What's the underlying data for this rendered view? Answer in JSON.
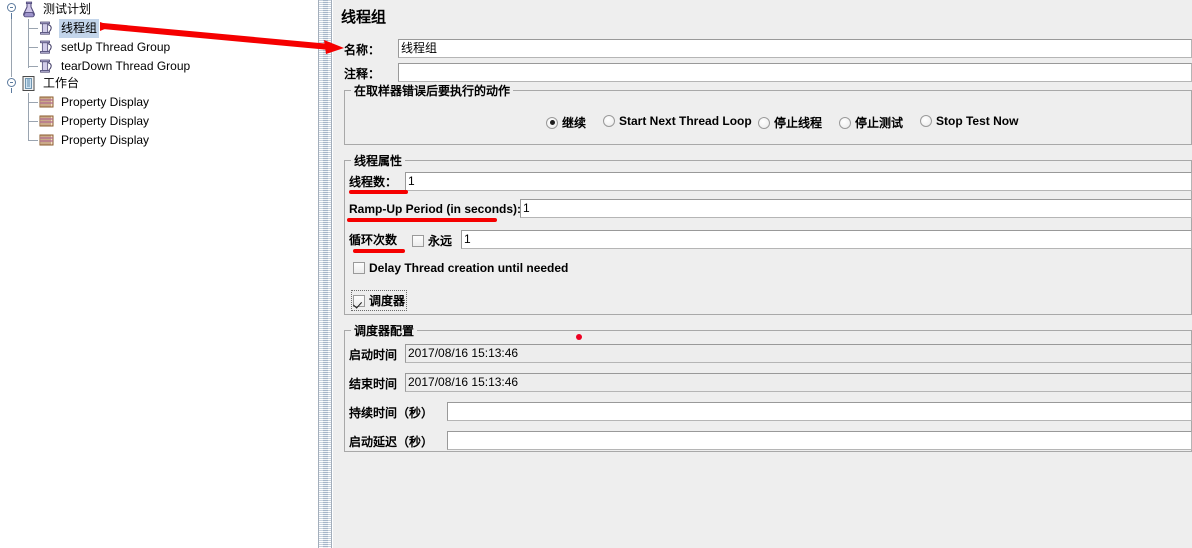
{
  "tree": {
    "items": [
      {
        "label": "测试计划",
        "icon": "flask-icon",
        "depth": 0,
        "selected": false
      },
      {
        "label": "线程组",
        "icon": "thread-group-icon",
        "depth": 1,
        "selected": true
      },
      {
        "label": "setUp Thread Group",
        "icon": "thread-group-icon",
        "depth": 1,
        "selected": false
      },
      {
        "label": "tearDown Thread Group",
        "icon": "thread-group-icon",
        "depth": 1,
        "selected": false
      },
      {
        "label": "工作台",
        "icon": "workbench-icon",
        "depth": 0,
        "selected": false
      },
      {
        "label": "Property Display",
        "icon": "property-display-icon",
        "depth": 1,
        "selected": false
      },
      {
        "label": "Property Display",
        "icon": "property-display-icon",
        "depth": 1,
        "selected": false
      },
      {
        "label": "Property Display",
        "icon": "property-display-icon",
        "depth": 1,
        "selected": false
      }
    ]
  },
  "panel": {
    "title": "线程组",
    "name_label": "名称：",
    "name_value": "线程组",
    "comment_label": "注释：",
    "comment_value": ""
  },
  "error_action": {
    "group_title": "在取样器错误后要执行的动作",
    "options": [
      {
        "label": "继续",
        "selected": true
      },
      {
        "label": "Start Next Thread Loop",
        "selected": false
      },
      {
        "label": "停止线程",
        "selected": false
      },
      {
        "label": "停止测试",
        "selected": false
      },
      {
        "label": "Stop Test Now",
        "selected": false
      }
    ]
  },
  "thread_properties": {
    "group_title": "线程属性",
    "num_threads_label": "线程数：",
    "num_threads_value": "1",
    "ramp_up_label": "Ramp-Up Period (in seconds):",
    "ramp_up_value": "1",
    "loop_count_label": "循环次数",
    "forever_label": "永远",
    "forever_checked": false,
    "loop_count_value": "1",
    "delay_creation_label": "Delay Thread creation until needed",
    "delay_creation_checked": false,
    "scheduler_label": "调度器",
    "scheduler_checked": true
  },
  "scheduler": {
    "group_title": "调度器配置",
    "start_time_label": "启动时间",
    "start_time_value": "2017/08/16 15:13:46",
    "end_time_label": "结束时间",
    "end_time_value": "2017/08/16 15:13:46",
    "duration_label": "持续时间（秒）",
    "duration_value": "",
    "startup_delay_label": "启动延迟（秒）",
    "startup_delay_value": ""
  },
  "annotations": {
    "arrow_color": "#f50000",
    "underline_color": "#f50000",
    "dot_color": "#ee0022",
    "arrow_from": "线程组 tree node",
    "arrow_to": "名称 field label",
    "underlined_labels": [
      "线程数：",
      "Ramp-Up Period (in seconds):",
      "循环次数"
    ]
  }
}
